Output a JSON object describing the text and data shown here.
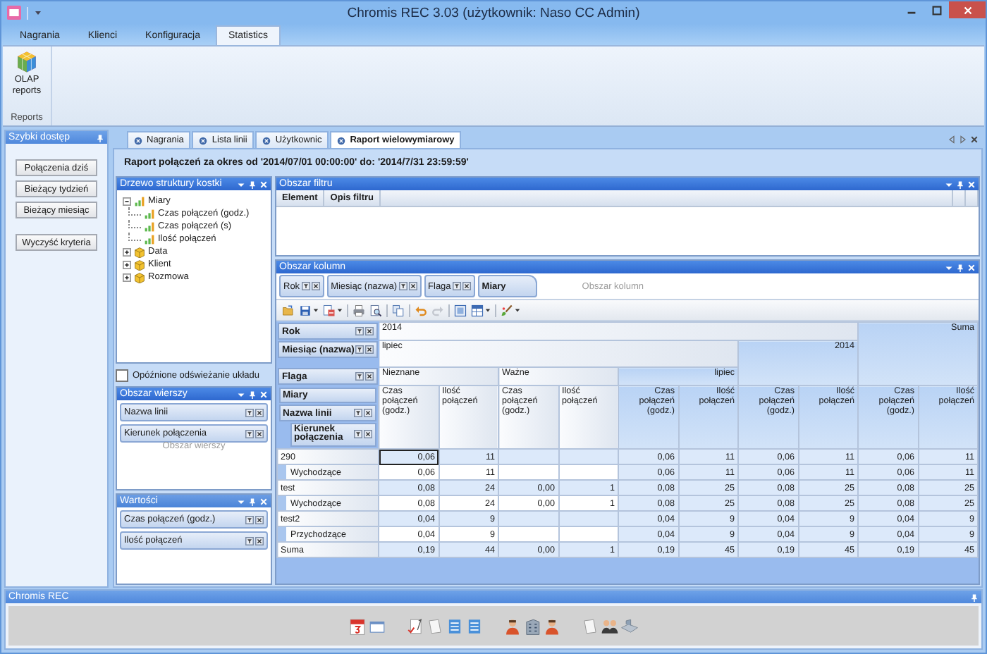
{
  "window": {
    "title": "Chromis REC 3.03 (użytkownik: Naso CC Admin)"
  },
  "ribbon": {
    "tabs": [
      {
        "label": "Nagrania",
        "selected": false
      },
      {
        "label": "Klienci",
        "selected": false
      },
      {
        "label": "Konfiguracja",
        "selected": false
      },
      {
        "label": "Statistics",
        "selected": true
      }
    ],
    "group": {
      "label": "Reports",
      "button": "OLAP reports"
    }
  },
  "quick_access": {
    "title": "Szybki dostęp",
    "buttons": [
      "Połączenia dziś",
      "Bieżący tydzień",
      "Bieżący miesiąc"
    ],
    "clear_button": "Wyczyść kryteria"
  },
  "document_tabs": [
    {
      "label": "Nagrania",
      "selected": false
    },
    {
      "label": "Lista linii",
      "selected": false
    },
    {
      "label": "Użytkownic",
      "selected": false
    },
    {
      "label": "Raport wielowymiarowy",
      "selected": true
    }
  ],
  "report": {
    "header": "Raport połączeń za okres od '2014/07/01 00:00:00' do: '2014/7/31 23:59:59'"
  },
  "cube_tree": {
    "title": "Drzewo struktury kostki",
    "items": [
      {
        "label": "Miary",
        "kind": "measures",
        "expanded": true,
        "children": [
          {
            "label": "Czas połączeń (godz.)"
          },
          {
            "label": "Czas połączeń (s)"
          },
          {
            "label": "Ilość połączeń"
          }
        ]
      },
      {
        "label": "Data",
        "kind": "dimension",
        "expanded": false
      },
      {
        "label": "Klient",
        "kind": "dimension",
        "expanded": false
      },
      {
        "label": "Rozmowa",
        "kind": "dimension",
        "expanded": false
      }
    ]
  },
  "delayed_update": {
    "label": "Opóźnione odświeżanie układu",
    "checked": false
  },
  "row_area": {
    "title": "Obszar wierszy",
    "fields": [
      "Nazwa linii",
      "Kierunek połączenia"
    ],
    "drop_hint": "Obszar wierszy"
  },
  "values_area": {
    "title": "Wartości",
    "fields": [
      "Czas połączeń (godz.)",
      "Ilość połączeń"
    ]
  },
  "filter_area": {
    "title": "Obszar filtru",
    "columns": [
      "Element",
      "Opis filtru"
    ]
  },
  "column_area": {
    "title": "Obszar kolumn",
    "fields": [
      {
        "label": "Rok",
        "kind": "dimension"
      },
      {
        "label": "Miesiąc (nazwa)",
        "kind": "dimension"
      },
      {
        "label": "Flaga",
        "kind": "dimension"
      },
      {
        "label": "Miary",
        "kind": "measures"
      }
    ],
    "drop_hint": "Obszar kolumn"
  },
  "pivot": {
    "corner_fields": [
      {
        "label": "Rok",
        "kind": "dimension"
      },
      {
        "label": "Miesiąc (nazwa)",
        "kind": "dimension"
      },
      {
        "label": "Flaga",
        "kind": "dimension"
      },
      {
        "label": "Miary",
        "kind": "measures"
      },
      {
        "label": "Nazwa linii",
        "kind": "dimension"
      },
      {
        "label": "Kierunek połączenia",
        "kind": "nested_dimension"
      }
    ],
    "columns": {
      "years": [
        {
          "label": "2014",
          "months": [
            {
              "label": "lipiec",
              "flags": [
                {
                  "label": "Nieznane",
                  "measures": [
                    "Czas połączeń (godz.)",
                    "Ilość połączeń"
                  ]
                },
                {
                  "label": "Ważne",
                  "measures": [
                    "Czas połączeń (godz.)",
                    "Ilość połączeń"
                  ]
                }
              ],
              "total": {
                "label": "lipiec",
                "measures": [
                  "Czas połączeń (godz.)",
                  "Ilość połączeń"
                ]
              }
            }
          ],
          "total": {
            "label": "2014",
            "measures": [
              "Czas połączeń (godz.)",
              "Ilość połączeń"
            ]
          }
        }
      ],
      "grand_total": {
        "label": "Suma",
        "measures": [
          "Czas połączeń (godz.)",
          "Ilość połączeń"
        ]
      }
    },
    "rows": [
      {
        "label": "290",
        "selected": true,
        "cells": [
          {
            "kind": "value",
            "text": "0,06"
          },
          {
            "kind": "value",
            "text": "11"
          },
          {
            "kind": "empty"
          },
          {
            "kind": "empty"
          },
          {
            "kind": "value",
            "text": "0,06"
          },
          {
            "kind": "value",
            "text": "11"
          },
          {
            "kind": "value",
            "text": "0,06"
          },
          {
            "kind": "value",
            "text": "11"
          },
          {
            "kind": "value",
            "text": "0,06"
          },
          {
            "kind": "value",
            "text": "11"
          }
        ],
        "children": [
          {
            "label": "Wychodzące",
            "cells": [
              {
                "kind": "value",
                "text": "0,06"
              },
              {
                "kind": "value",
                "text": "11"
              },
              {
                "kind": "empty"
              },
              {
                "kind": "empty"
              },
              {
                "kind": "value",
                "text": "0,06"
              },
              {
                "kind": "value",
                "text": "11"
              },
              {
                "kind": "value",
                "text": "0,06"
              },
              {
                "kind": "value",
                "text": "11"
              },
              {
                "kind": "value",
                "text": "0,06"
              },
              {
                "kind": "value",
                "text": "11"
              }
            ]
          }
        ]
      },
      {
        "label": "test",
        "selected": false,
        "cells": [
          {
            "kind": "value",
            "text": "0,08"
          },
          {
            "kind": "value",
            "text": "24"
          },
          {
            "kind": "value",
            "text": "0,00"
          },
          {
            "kind": "value",
            "text": "1"
          },
          {
            "kind": "value",
            "text": "0,08"
          },
          {
            "kind": "value",
            "text": "25"
          },
          {
            "kind": "value",
            "text": "0,08"
          },
          {
            "kind": "value",
            "text": "25"
          },
          {
            "kind": "value",
            "text": "0,08"
          },
          {
            "kind": "value",
            "text": "25"
          }
        ],
        "children": [
          {
            "label": "Wychodzące",
            "cells": [
              {
                "kind": "value",
                "text": "0,08"
              },
              {
                "kind": "value",
                "text": "24"
              },
              {
                "kind": "value",
                "text": "0,00"
              },
              {
                "kind": "value",
                "text": "1"
              },
              {
                "kind": "value",
                "text": "0,08"
              },
              {
                "kind": "value",
                "text": "25"
              },
              {
                "kind": "value",
                "text": "0,08"
              },
              {
                "kind": "value",
                "text": "25"
              },
              {
                "kind": "value",
                "text": "0,08"
              },
              {
                "kind": "value",
                "text": "25"
              }
            ]
          }
        ]
      },
      {
        "label": "test2",
        "selected": false,
        "cells": [
          {
            "kind": "value",
            "text": "0,04"
          },
          {
            "kind": "value",
            "text": "9"
          },
          {
            "kind": "empty"
          },
          {
            "kind": "empty"
          },
          {
            "kind": "value",
            "text": "0,04"
          },
          {
            "kind": "value",
            "text": "9"
          },
          {
            "kind": "value",
            "text": "0,04"
          },
          {
            "kind": "value",
            "text": "9"
          },
          {
            "kind": "value",
            "text": "0,04"
          },
          {
            "kind": "value",
            "text": "9"
          }
        ],
        "children": [
          {
            "label": "Przychodzące",
            "cells": [
              {
                "kind": "value",
                "text": "0,04"
              },
              {
                "kind": "value",
                "text": "9"
              },
              {
                "kind": "empty"
              },
              {
                "kind": "empty"
              },
              {
                "kind": "value",
                "text": "0,04"
              },
              {
                "kind": "value",
                "text": "9"
              },
              {
                "kind": "value",
                "text": "0,04"
              },
              {
                "kind": "value",
                "text": "9"
              },
              {
                "kind": "value",
                "text": "0,04"
              },
              {
                "kind": "value",
                "text": "9"
              }
            ]
          }
        ]
      }
    ],
    "total": {
      "label": "Suma",
      "cells": [
        {
          "kind": "value",
          "text": "0,19"
        },
        {
          "kind": "value",
          "text": "44"
        },
        {
          "kind": "value",
          "text": "0,00"
        },
        {
          "kind": "value",
          "text": "1"
        },
        {
          "kind": "value",
          "text": "0,19"
        },
        {
          "kind": "value",
          "text": "45"
        },
        {
          "kind": "value",
          "text": "0,19"
        },
        {
          "kind": "value",
          "text": "45"
        },
        {
          "kind": "value",
          "text": "0,19"
        },
        {
          "kind": "value",
          "text": "45"
        }
      ]
    }
  },
  "status_panel": {
    "title": "Chromis REC"
  }
}
